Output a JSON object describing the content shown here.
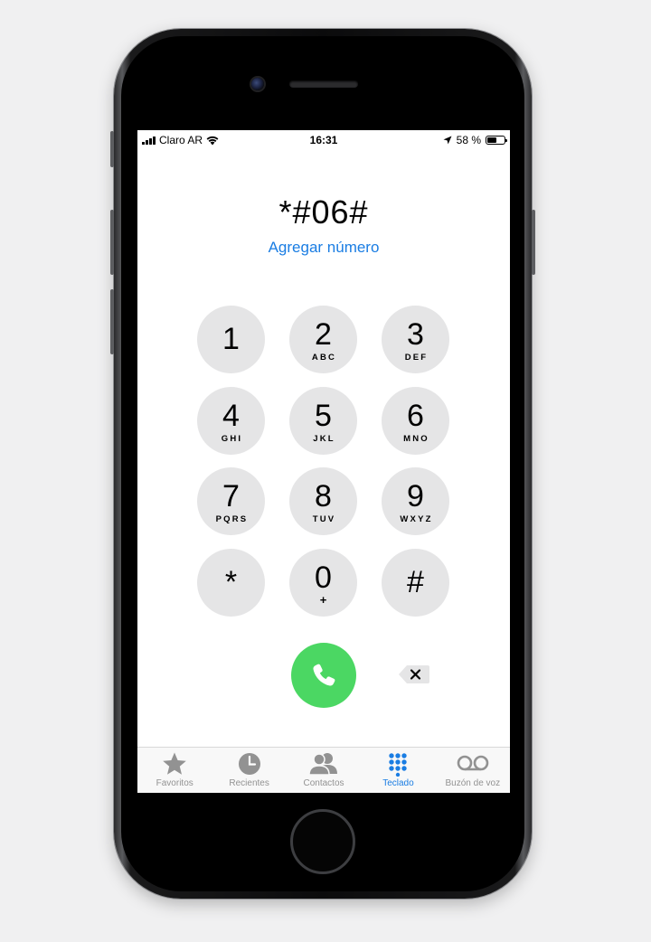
{
  "status_bar": {
    "carrier": "Claro AR",
    "time": "16:31",
    "battery_percent": "58 %",
    "battery_level": 0.58
  },
  "dialer": {
    "number": "*#06#",
    "add_number": "Agregar número"
  },
  "keypad": [
    {
      "digit": "1",
      "letters": ""
    },
    {
      "digit": "2",
      "letters": "ABC"
    },
    {
      "digit": "3",
      "letters": "DEF"
    },
    {
      "digit": "4",
      "letters": "GHI"
    },
    {
      "digit": "5",
      "letters": "JKL"
    },
    {
      "digit": "6",
      "letters": "MNO"
    },
    {
      "digit": "7",
      "letters": "PQRS"
    },
    {
      "digit": "8",
      "letters": "TUV"
    },
    {
      "digit": "9",
      "letters": "WXYZ"
    },
    {
      "digit": "*",
      "letters": ""
    },
    {
      "digit": "0",
      "letters": "+"
    },
    {
      "digit": "#",
      "letters": ""
    }
  ],
  "tabs": [
    {
      "label": "Favoritos",
      "icon": "star-icon",
      "active": false
    },
    {
      "label": "Recientes",
      "icon": "clock-icon",
      "active": false
    },
    {
      "label": "Contactos",
      "icon": "contacts-icon",
      "active": false
    },
    {
      "label": "Teclado",
      "icon": "keypad-icon",
      "active": true
    },
    {
      "label": "Buzón de voz",
      "icon": "voicemail-icon",
      "active": false
    }
  ],
  "colors": {
    "accent": "#1a7de3",
    "call_green": "#4bd763",
    "key_gray": "#e5e5e6",
    "inactive_tab": "#929292"
  }
}
